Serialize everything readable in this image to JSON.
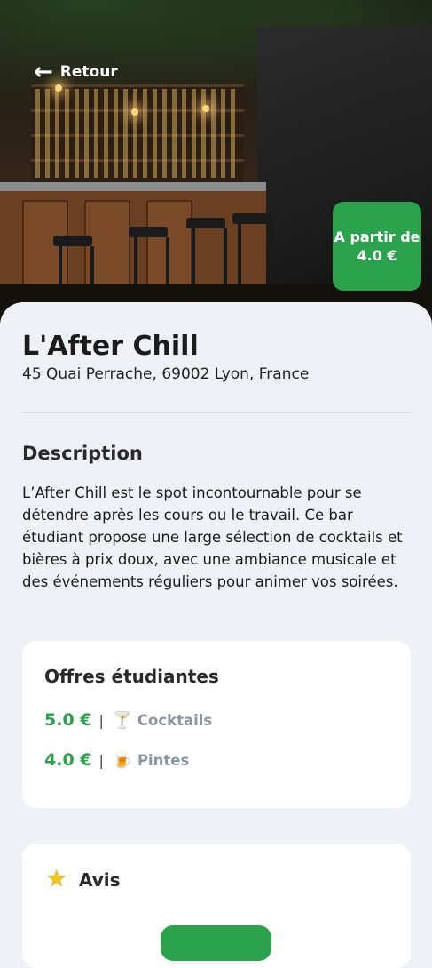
{
  "header": {
    "back_label": "Retour",
    "back_icon": "arrow-left-icon"
  },
  "price_badge": {
    "line1": "A partir de",
    "line2": "4.0 €"
  },
  "venue": {
    "name": "L'After Chill",
    "address": "45 Quai Perrache, 69002 Lyon, France"
  },
  "description": {
    "title": "Description",
    "text": "L’After Chill est le spot incontournable pour se détendre après les cours ou le travail. Ce bar étudiant propose une large sélection de cocktails et bières à prix doux, avec une ambiance musicale et des événements réguliers pour animer vos soirées."
  },
  "offers": {
    "title": "Offres étudiantes",
    "items": [
      {
        "price": "5.0 €",
        "separator": "|",
        "emoji": "🍸",
        "name": "Cocktails"
      },
      {
        "price": "4.0 €",
        "separator": "|",
        "emoji": "🍺",
        "name": "Pintes"
      }
    ]
  },
  "reviews": {
    "title": "Avis",
    "icon": "star-icon",
    "button_label": ""
  },
  "colors": {
    "accent_green": "#2ba24c",
    "background": "#eef1f6",
    "muted_text": "#8c96a2"
  }
}
